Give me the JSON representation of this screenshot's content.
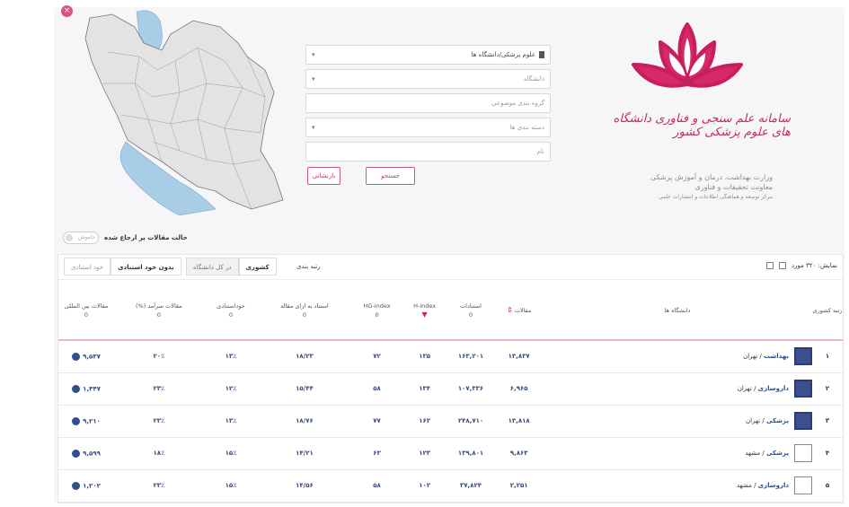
{
  "map": {
    "close": "×"
  },
  "search": {
    "university_type": "علوم پزشکی/دانشگاه ها",
    "university_placeholder": "دانشگاه",
    "subject_placeholder": "گروه بندی موضوعی",
    "category_placeholder": "دسته بندی ها",
    "name_placeholder": "نام",
    "search_label": "جستجو",
    "reset_label": "بازنشانی"
  },
  "brand": {
    "title": "سامانه علم سنجی و فناوری دانشگاه های علوم پزشکی کشور",
    "ministry_line1": "وزارت بهداشت، درمان و آموزش پزشکی",
    "ministry_line2": "معاونت تحقیقات و فناوری",
    "ministry_line3": "مرکز توسعه و هماهنگی اطلاعات و انتشارات علمی"
  },
  "toggle": {
    "label": "حالت مقالات پر ارجاع شده",
    "state": "خاموش"
  },
  "tabs": {
    "group1": [
      "خود استنادی",
      "بدون خود استنادی"
    ],
    "group2": [
      "در کل دانشگاه",
      "کشوری"
    ],
    "rank_label": "رتبه بندی",
    "results": "نمایش: ۳۲۰ مورد"
  },
  "table": {
    "headers": {
      "rank": "رتبه کشوری",
      "university": "دانشگاه ها",
      "articles": "مقالات",
      "citations": "استنادات",
      "h_index": "H-index",
      "hg_index": "HG-index",
      "cpp": "استناد به ازای مقاله",
      "self": "خوداستنادی",
      "share": "مقالات سرآمد (%)",
      "intl": "مقالات بین المللی",
      "zero": "0"
    },
    "rows": [
      {
        "rank": "۱",
        "uni_type": "بهداشت",
        "uni_city": "تهران",
        "articles": "۱۳,۸۳۷",
        "citations": "۱۶۳,۲۰۱",
        "h": "۱۳۵",
        "hg": "۷۲",
        "cpp": "۱۸/۲۳",
        "self": "۱۳٪",
        "share": "۲۰٪",
        "intl": "۹,۵۳۷"
      },
      {
        "rank": "۲",
        "uni_type": "داروسازی",
        "uni_city": "تهران",
        "articles": "۶,۹۶۵",
        "citations": "۱۰۷,۳۳۶",
        "h": "۱۳۴",
        "hg": "۵۸",
        "cpp": "۱۵/۴۴",
        "self": "۱۲٪",
        "share": "۲۳٪",
        "intl": "۱,۴۴۷"
      },
      {
        "rank": "۳",
        "uni_type": "پزشکی",
        "uni_city": "تهران",
        "articles": "۱۳,۸۱۸",
        "citations": "۲۴۸,۷۱۰",
        "h": "۱۶۲",
        "hg": "۷۷",
        "cpp": "۱۸/۷۶",
        "self": "۱۳٪",
        "share": "۲۳٪",
        "intl": "۹,۲۱۰"
      },
      {
        "rank": "۴",
        "uni_type": "پزشکی",
        "uni_city": "مشهد",
        "articles": "۹,۸۶۳",
        "citations": "۱۳۹,۸۰۱",
        "h": "۱۲۳",
        "hg": "۶۳",
        "cpp": "۱۴/۲۱",
        "self": "۱۵٪",
        "share": "۱۸٪",
        "intl": "۹,۵۹۹"
      },
      {
        "rank": "۵",
        "uni_type": "داروسازی",
        "uni_city": "مشهد",
        "articles": "۲,۲۵۱",
        "citations": "۳۷,۸۲۴",
        "h": "۱۰۲",
        "hg": "۵۸",
        "cpp": "۱۴/۵۶",
        "self": "۱۵٪",
        "share": "۲۳٪",
        "intl": "۱,۲۰۲"
      }
    ]
  }
}
